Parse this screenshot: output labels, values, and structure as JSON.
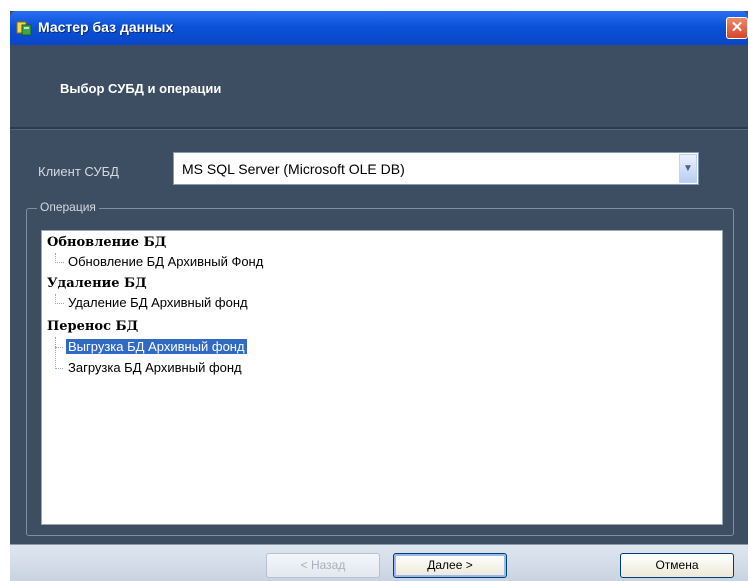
{
  "window": {
    "title": "Мастер баз данных",
    "icons": {
      "app": "database-icon",
      "close": "close-icon"
    }
  },
  "header": {
    "title": "Выбор СУБД и операции"
  },
  "client": {
    "label": "Клиент СУБД",
    "value": "MS SQL Server (Microsoft OLE DB)",
    "dropdown_icon": "chevron-down-icon"
  },
  "operations": {
    "legend": "Операция",
    "groups": [
      {
        "label": "Обновление БД",
        "items": [
          {
            "label": "Обновление БД Архивный Фонд",
            "selected": false
          }
        ]
      },
      {
        "label": "Удаление БД",
        "items": [
          {
            "label": "Удаление БД Архивный фонд",
            "selected": false
          }
        ]
      },
      {
        "label": "Перенос БД",
        "items": [
          {
            "label": "Выгрузка БД Архивный фонд",
            "selected": true
          },
          {
            "label": "Загрузка БД Архивный фонд",
            "selected": false
          }
        ]
      }
    ]
  },
  "buttons": {
    "back": "< Назад",
    "next": "Далее >",
    "cancel": "Отмена"
  },
  "colors": {
    "title_bar": "#0a52d8",
    "panel": "#3d4d62",
    "selection": "#316ac5"
  }
}
